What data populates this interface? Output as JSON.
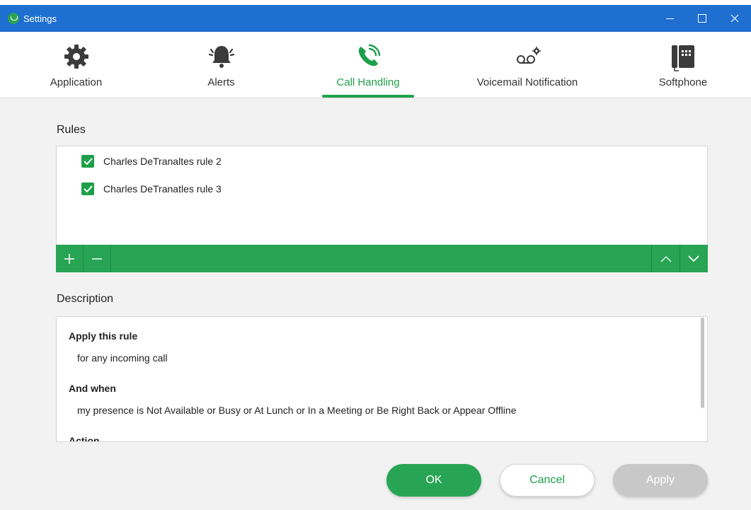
{
  "window": {
    "title": "Settings"
  },
  "tabs": [
    {
      "label": "Application",
      "icon": "gear-icon"
    },
    {
      "label": "Alerts",
      "icon": "bell-icon"
    },
    {
      "label": "Call Handling",
      "icon": "phone-ringing-icon",
      "active": true
    },
    {
      "label": "Voicemail Notification",
      "icon": "voicemail-icon"
    },
    {
      "label": "Softphone",
      "icon": "desk-phone-icon"
    }
  ],
  "rules": {
    "label": "Rules",
    "items": [
      {
        "label": "Charles DeTranaltes rule 2",
        "checked": true
      },
      {
        "label": "Charles DeTranatles rule 3",
        "checked": true
      }
    ]
  },
  "description": {
    "label": "Description",
    "sections": [
      {
        "heading": "Apply this rule",
        "text": "for any incoming call"
      },
      {
        "heading": "And when",
        "text": "my presence is Not Available or Busy or At Lunch or In a Meeting or Be Right Back or Appear Offline"
      },
      {
        "heading": "Action",
        "text": ""
      }
    ]
  },
  "buttons": {
    "ok": "OK",
    "cancel": "Cancel",
    "apply": "Apply"
  },
  "colors": {
    "accent": "#1ea04b",
    "titlebar": "#1e6fd0",
    "toolbar": "#27a454",
    "disabled": "#c8c8c8"
  }
}
